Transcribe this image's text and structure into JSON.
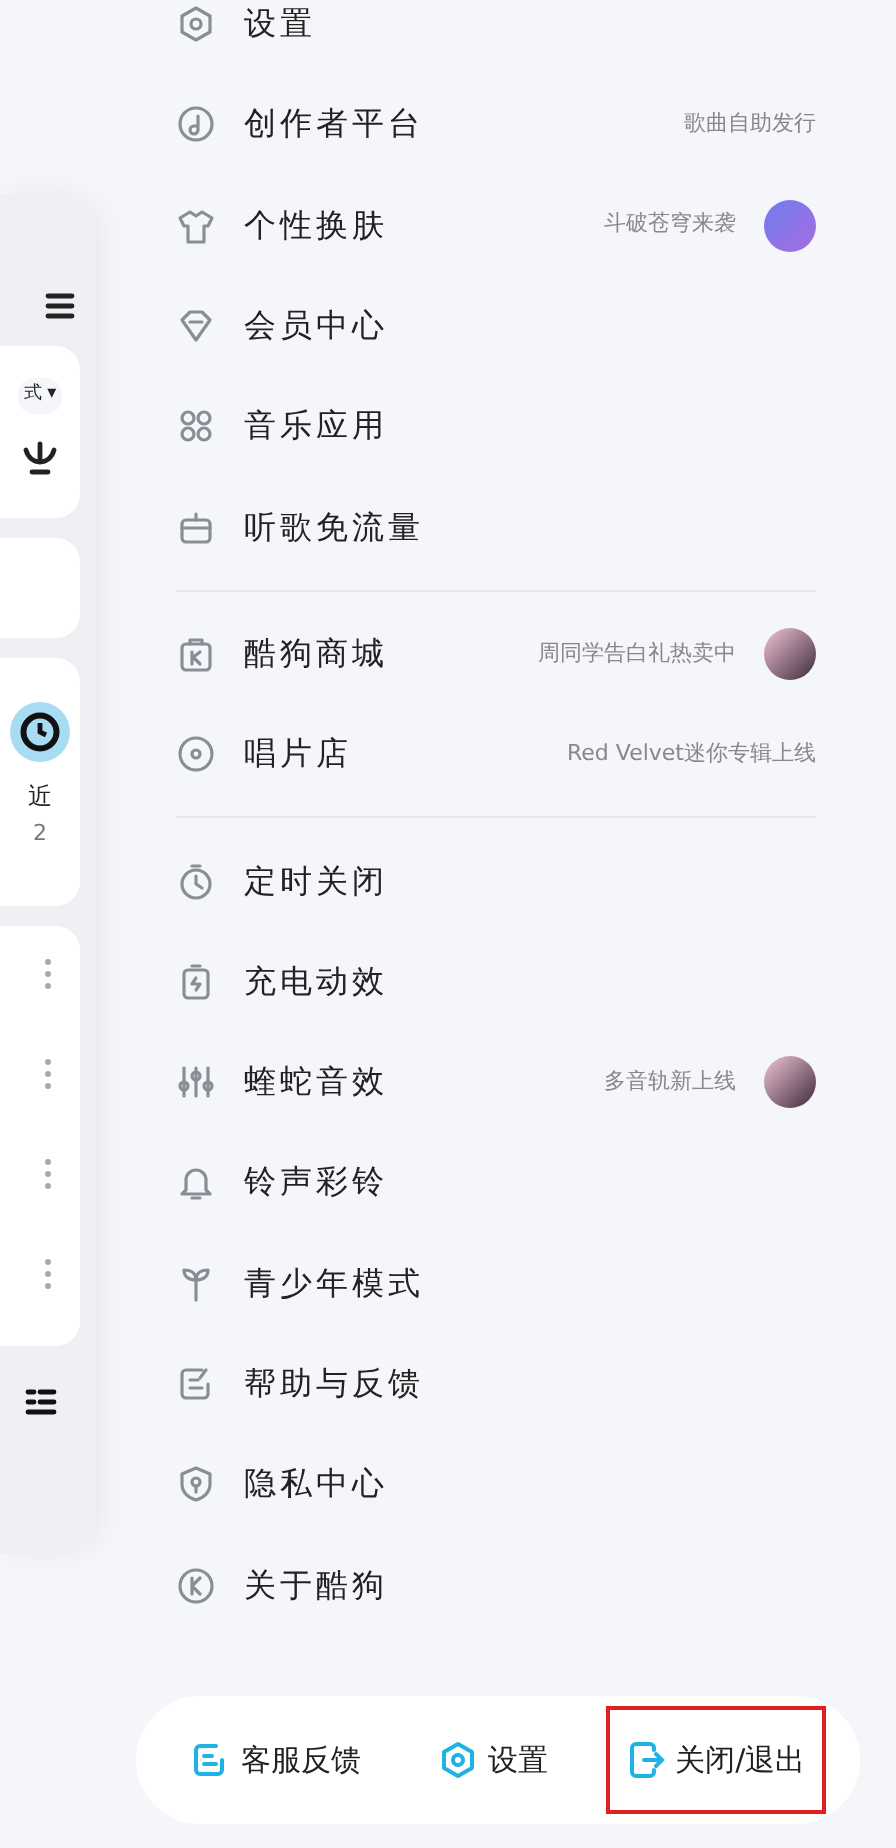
{
  "background_app": {
    "mode_selector": "式 ▾",
    "recent_label": "近",
    "recent_count": "2"
  },
  "menu_groups": [
    {
      "items": [
        {
          "label": "设置"
        },
        {
          "label": "创作者平台",
          "subtitle": "歌曲自助发行"
        },
        {
          "label": "个性换肤",
          "subtitle": "斗破苍穹来袭",
          "avatar": true
        },
        {
          "label": "会员中心"
        },
        {
          "label": "音乐应用"
        },
        {
          "label": "听歌免流量"
        }
      ]
    },
    {
      "items": [
        {
          "label": "酷狗商城",
          "subtitle": "周同学告白礼热卖中",
          "avatar": true
        },
        {
          "label": "唱片店",
          "subtitle": "Red Velvet迷你专辑上线"
        }
      ]
    },
    {
      "items": [
        {
          "label": "定时关闭"
        },
        {
          "label": "充电动效"
        },
        {
          "label": "蝰蛇音效",
          "subtitle": "多音轨新上线",
          "avatar": true
        },
        {
          "label": "铃声彩铃"
        },
        {
          "label": "青少年模式"
        },
        {
          "label": "帮助与反馈"
        },
        {
          "label": "隐私中心"
        },
        {
          "label": "关于酷狗"
        }
      ]
    }
  ],
  "bottom_bar": [
    {
      "label": "客服反馈",
      "highlighted": false
    },
    {
      "label": "设置",
      "highlighted": false
    },
    {
      "label": "关闭/退出",
      "highlighted": true
    }
  ]
}
